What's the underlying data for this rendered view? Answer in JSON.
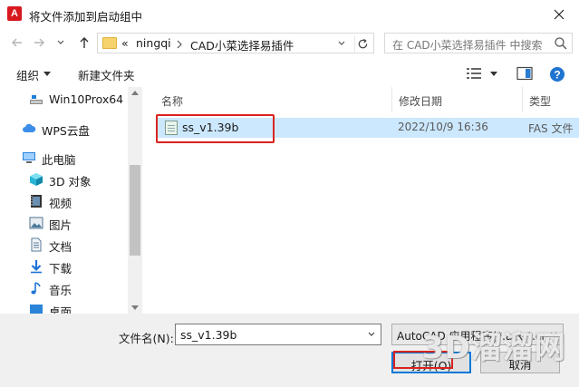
{
  "window": {
    "title": "将文件添加到启动组中",
    "app_icon_letter": "A"
  },
  "nav": {
    "breadcrumb": [
      "«",
      "ningqi",
      "CAD小菜选择易插件"
    ],
    "search_placeholder": "在 CAD小菜选择易插件 中搜索"
  },
  "toolbar": {
    "organize_label": "组织",
    "new_folder_label": "新建文件夹"
  },
  "sidebar": {
    "items": [
      {
        "label": "Win10Prox64 (",
        "icon": "drive-icon"
      },
      {
        "label": "WPS云盘",
        "icon": "cloud-icon"
      },
      {
        "label": "此电脑",
        "icon": "computer-icon"
      },
      {
        "label": "3D 对象",
        "icon": "3d-objects-icon"
      },
      {
        "label": "视频",
        "icon": "video-icon"
      },
      {
        "label": "图片",
        "icon": "pictures-icon"
      },
      {
        "label": "文档",
        "icon": "documents-icon"
      },
      {
        "label": "下载",
        "icon": "download-icon"
      },
      {
        "label": "音乐",
        "icon": "music-icon"
      },
      {
        "label": "桌面",
        "icon": "desktop-icon"
      }
    ]
  },
  "columns": {
    "name": "名称",
    "modified": "修改日期",
    "type": "类型"
  },
  "files": [
    {
      "name": "ss_v1.39b",
      "modified": "2022/10/9 16:36",
      "type": "FAS 文件"
    }
  ],
  "bottom": {
    "filename_label": "文件名(N):",
    "filename_value": "ss_v1.39b",
    "filter_value": "AutoCAD 应用程序(*.arx;*.crx;",
    "open_label": "打开(O)",
    "cancel_label": "取消"
  },
  "watermark": {
    "text": "3D溜溜网"
  },
  "colors": {
    "selection": "#cce8ff",
    "highlight_red": "#d9231f",
    "focus_blue": "#0078d7",
    "app_red": "#d7191f"
  }
}
